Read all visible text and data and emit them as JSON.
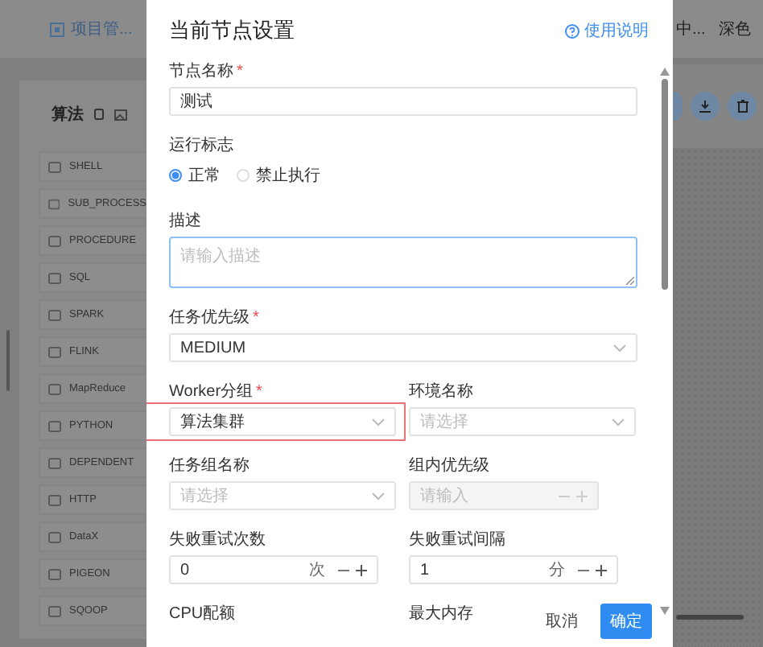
{
  "header": {
    "project_tab": "项目管...",
    "right_texts": [
      "中...",
      "深色"
    ]
  },
  "palette": {
    "title": "算法",
    "items": [
      {
        "label": "SHELL"
      },
      {
        "label": "SUB_PROCESS"
      },
      {
        "label": "PROCEDURE"
      },
      {
        "label": "SQL"
      },
      {
        "label": "SPARK"
      },
      {
        "label": "FLINK"
      },
      {
        "label": "MapReduce"
      },
      {
        "label": "PYTHON"
      },
      {
        "label": "DEPENDENT"
      },
      {
        "label": "HTTP"
      },
      {
        "label": "DataX"
      },
      {
        "label": "PIGEON"
      },
      {
        "label": "SQOOP"
      }
    ]
  },
  "drawer": {
    "title": "当前节点设置",
    "help_link": "使用说明",
    "rows": [
      [
        {
          "kind": "input",
          "label": "节点名称",
          "required_mark": "*",
          "value": "测试"
        }
      ],
      [
        {
          "kind": "radio",
          "label": "运行标志",
          "options": [
            {
              "label": "正常",
              "selected": true
            },
            {
              "label": "禁止执行",
              "selected": false
            }
          ]
        }
      ],
      [
        {
          "kind": "textarea",
          "label": "描述",
          "placeholder": "请输入描述",
          "focused": true
        }
      ],
      [
        {
          "kind": "select",
          "label": "任务优先级",
          "required_mark": "*",
          "value": "MEDIUM"
        }
      ],
      [
        {
          "kind": "select",
          "label": "Worker分组",
          "required_mark": "*",
          "value": "算法集群",
          "highlighted": true
        },
        {
          "kind": "select",
          "label": "环境名称",
          "placeholder": "请选择"
        }
      ],
      [
        {
          "kind": "select",
          "label": "任务组名称",
          "placeholder": "请选择"
        },
        {
          "kind": "number",
          "label": "组内优先级",
          "placeholder": "请输入",
          "disabled": true
        }
      ],
      [
        {
          "kind": "number",
          "label": "失败重试次数",
          "value": "0",
          "unit": "次",
          "disabled": false
        },
        {
          "kind": "number",
          "label": "失败重试间隔",
          "value": "1",
          "unit": "分",
          "disabled": false
        }
      ],
      [
        {
          "kind": "label",
          "label": "CPU配额"
        },
        {
          "kind": "label",
          "label": "最大内存"
        }
      ]
    ],
    "buttons": [
      {
        "label": "取消",
        "kind": "secondary"
      },
      {
        "label": "确定",
        "kind": "primary"
      }
    ]
  }
}
